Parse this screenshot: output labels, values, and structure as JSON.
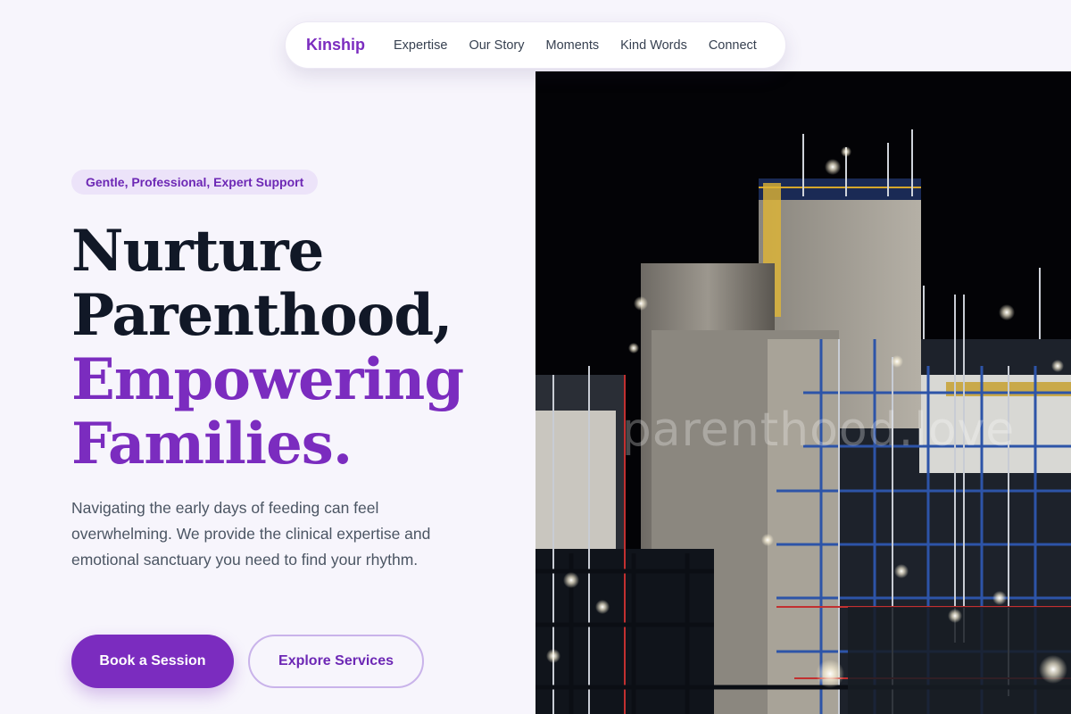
{
  "nav": {
    "brand": "Kinship",
    "links": [
      "Expertise",
      "Our Story",
      "Moments",
      "Kind Words",
      "Connect"
    ]
  },
  "hero": {
    "badge": "Gentle, Professional, Expert Support",
    "headline_line1": "Nurture",
    "headline_line2": "Parenthood,",
    "headline_line3": "Empowering",
    "headline_line4": "Families.",
    "description": "Navigating the early days of feeding can feel overwhelming. We provide the clinical expertise and emotional sanctuary you need to find your rhythm.",
    "primary_cta": "Book a Session",
    "secondary_cta": "Explore Services"
  },
  "image": {
    "watermark": "parenthood.love"
  },
  "colors": {
    "accent": "#7b2cbf",
    "heading": "#111827",
    "body_text": "#4b5563",
    "page_bg": "#f7f5fc",
    "badge_bg": "#ece3f9"
  }
}
